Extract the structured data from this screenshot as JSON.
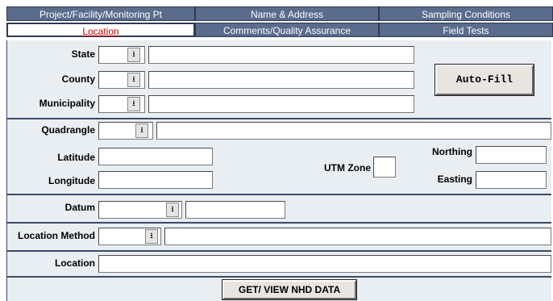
{
  "tabs": {
    "row1": [
      "Project/Facility/Monitoring Pt",
      "Name & Address",
      "Sampling Conditions"
    ],
    "row2": [
      "Location",
      "Comments/Quality Assurance",
      "Field Tests"
    ],
    "active": "Location"
  },
  "labels": {
    "state": "State",
    "county": "County",
    "municipality": "Municipality",
    "quadrangle": "Quadrangle",
    "latitude": "Latitude",
    "longitude": "Longitude",
    "utm_zone": "UTM Zone",
    "northing": "Northing",
    "easting": "Easting",
    "datum": "Datum",
    "location_method": "Location Method",
    "location": "Location"
  },
  "buttons": {
    "auto_fill": "Auto-Fill",
    "nhd": "GET/ VIEW NHD DATA"
  },
  "values": {
    "state_code": "",
    "state_name": "",
    "county_code": "",
    "county_name": "",
    "municipality_code": "",
    "municipality_name": "",
    "quadrangle_code": "",
    "quadrangle_name": "",
    "latitude": "",
    "longitude": "",
    "utm_zone": "",
    "northing": "",
    "easting": "",
    "datum_code": "",
    "datum_name": "",
    "location_method_code": "",
    "location_method_name": "",
    "location": ""
  },
  "icons": {
    "dropdown": "dropdown-arrow-icon"
  }
}
